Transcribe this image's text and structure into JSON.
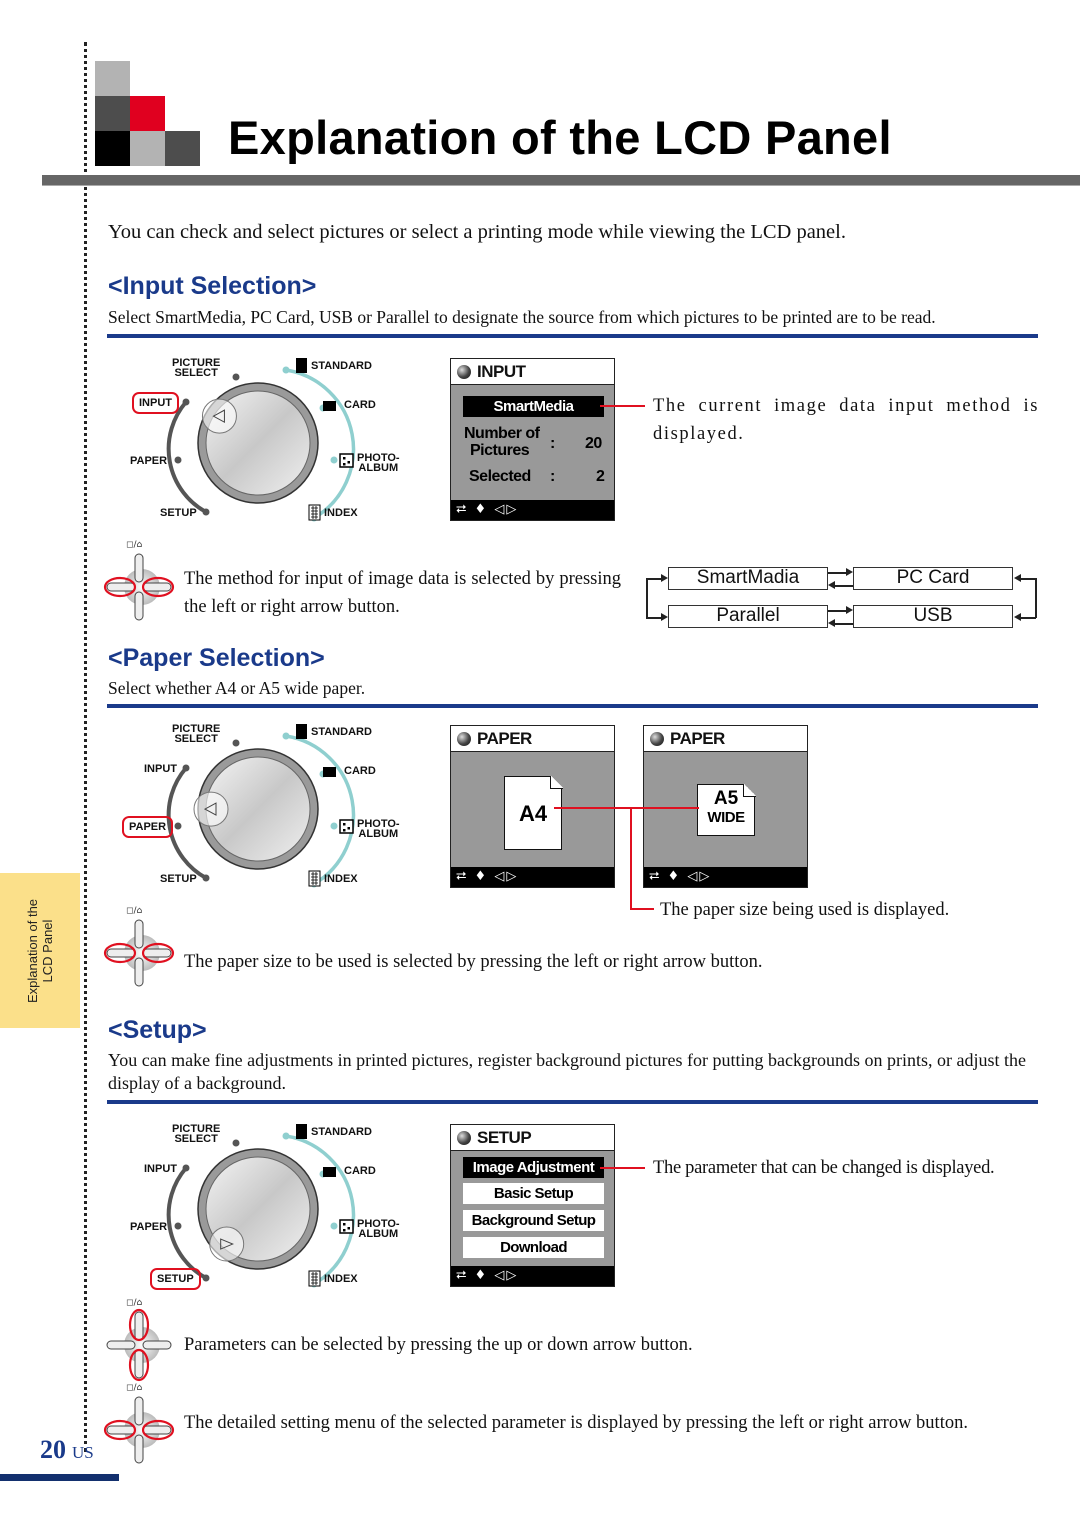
{
  "page": {
    "title": "Explanation of the LCD Panel",
    "intro": "You can check and select pictures or select a printing mode while viewing the LCD panel.",
    "side_tab": [
      "Explanation of the",
      "LCD Panel"
    ],
    "page_number": "20",
    "page_locale": "US",
    "colors": {
      "accent_blue": "#1a3a8a",
      "highlight_red": "#e01020",
      "tab_yellow": "#fbe08a",
      "dial_teal": "#8fcfcf"
    }
  },
  "dial_labels": {
    "picture_select": [
      "PICTURE",
      "SELECT"
    ],
    "input": "INPUT",
    "paper": "PAPER",
    "setup": "SETUP",
    "standard": "STANDARD",
    "card": "CARD",
    "photo_album": [
      "PHOTO-",
      "ALBUM"
    ],
    "index": "INDEX"
  },
  "dpad_label": "◻/⌂",
  "lcd_footer": "⮂ ♦ ◁▷",
  "input_section": {
    "heading": "<Input Selection>",
    "description": "Select SmartMedia, PC Card, USB or Parallel to designate the source from which pictures to be printed are to be read.",
    "highlighted_dial": "INPUT",
    "lcd": {
      "header": "INPUT",
      "selected": "SmartMedia",
      "rows": [
        {
          "label": [
            "Number of",
            "Pictures"
          ],
          "sep": ":",
          "value": "20"
        },
        {
          "label": [
            "Selected"
          ],
          "sep": ":",
          "value": "2"
        }
      ]
    },
    "callout": "The current image data input method is displayed.",
    "instruction": "The method for input of image data is selected by pressing the left or right arrow button.",
    "cycle": [
      "SmartMadia",
      "PC Card",
      "Parallel",
      "USB"
    ]
  },
  "paper_section": {
    "heading": "<Paper Selection>",
    "description": "Select whether A4 or A5 wide paper.",
    "highlighted_dial": "PAPER",
    "lcd_a": {
      "header": "PAPER",
      "size": "A4"
    },
    "lcd_b": {
      "header": "PAPER",
      "size": "A5",
      "size_sub": "WIDE"
    },
    "callout": "The paper size being used is displayed.",
    "instruction": "The paper size to be used is selected by pressing the left or right arrow button."
  },
  "setup_section": {
    "heading": "<Setup>",
    "description": "You can make fine adjustments in printed pictures, register background pictures for putting backgrounds on prints, or adjust the display of a background.",
    "highlighted_dial": "SETUP",
    "lcd": {
      "header": "SETUP",
      "items": [
        "Image Adjustment",
        "Basic Setup",
        "Background Setup",
        "Download"
      ],
      "selected_index": 0
    },
    "callout": "The parameter that can be changed is displayed.",
    "instruction_updown": "Parameters can be selected by pressing the up or down arrow button.",
    "instruction_leftright": "The detailed setting menu of the selected parameter is displayed by pressing the left or right arrow button."
  }
}
